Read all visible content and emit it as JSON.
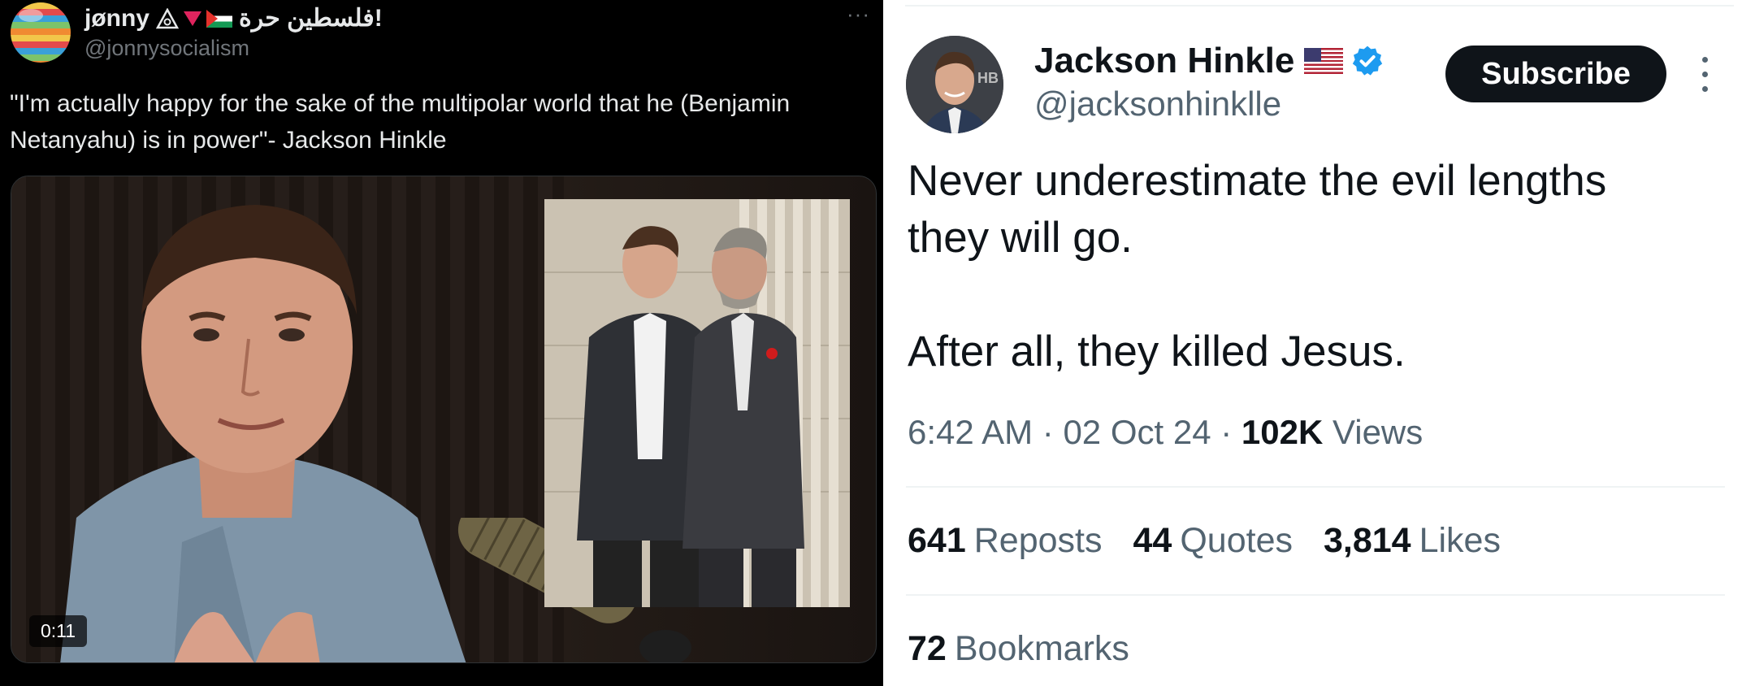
{
  "left_tweet": {
    "display_name": "jønny",
    "name_arabic": "فلسطين حرة!",
    "handle": "@jonnysocialism",
    "more_label": "···",
    "text": "\"I'm actually happy for the sake of the multipolar world that he (Benjamin Netanyahu) is in power\"- Jackson Hinkle",
    "video": {
      "duration": "0:11",
      "icons": [
        "avatar-image",
        "palestinian-flag-icon",
        "red-triangle-icon"
      ]
    }
  },
  "right_tweet": {
    "display_name": "Jackson Hinkle",
    "handle": "@jacksonhinklle",
    "subscribe_label": "Subscribe",
    "text": "Never underestimate the evil lengths\nthey will go.\n\nAfter all, they killed Jesus.",
    "time": "6:42 AM",
    "date": "02 Oct 24",
    "separator": "·",
    "views_count": "102K",
    "views_label": "Views",
    "reposts_count": "641",
    "reposts_label": "Reposts",
    "quotes_count": "44",
    "quotes_label": "Quotes",
    "likes_count": "3,814",
    "likes_label": "Likes",
    "bookmarks_count": "72",
    "bookmarks_label": "Bookmarks",
    "colors": {
      "verified": "#1d9bf0",
      "primary_text": "#0f1419",
      "secondary_text": "#536471"
    }
  }
}
